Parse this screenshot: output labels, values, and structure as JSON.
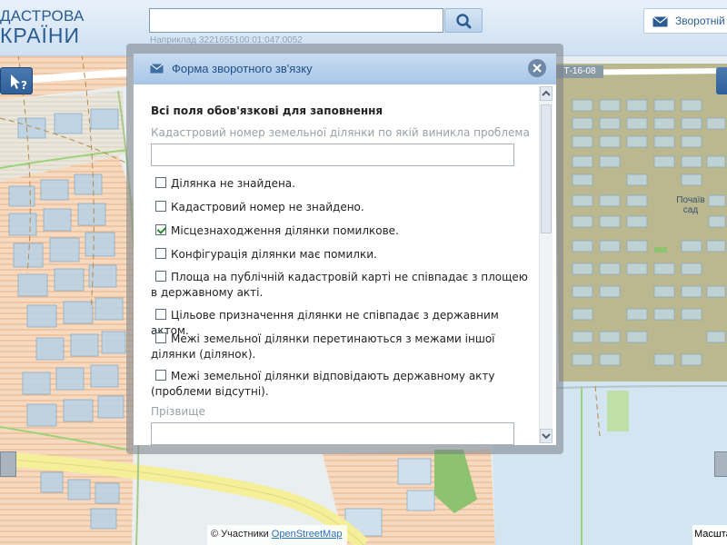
{
  "header": {
    "logo_line1": "ДАСТРОВА",
    "logo_line2": "КРАЇНИ",
    "search": {
      "value": "",
      "placeholder": ""
    },
    "search_hint": "Наприклад 3221655100:01:047:0052",
    "feedback_label": "Зворотній"
  },
  "dialog": {
    "title": "Форма зворотного зв'язку",
    "required_note": "Всі поля обов'язкові для заповнення",
    "cadastral_label": "Кадастровий номер земельної ділянки по якій виникла проблема",
    "cadastral_value": "",
    "checkboxes": [
      {
        "label": "Ділянка не знайдена.",
        "checked": false
      },
      {
        "label": "Кадастровий номер не знайдено.",
        "checked": false
      },
      {
        "label": "Місцезнаходження ділянки помилкове.",
        "checked": true
      },
      {
        "label": "Конфігурація ділянки має помилки.",
        "checked": false
      },
      {
        "label": "Площа на публічній кадастровій карті не співпадає з площею в державному акті.",
        "checked": false
      },
      {
        "label": "Цільове призначення ділянки не співпадає з державним актом.",
        "checked": false
      },
      {
        "label": "Межі земельної ділянки перетинаються з межами іншої ділянки (ділянок).",
        "checked": false
      },
      {
        "label": "Межі земельної ділянки відповідають державному акту (проблеми відсутні).",
        "checked": false
      }
    ],
    "surname_label": "Прізвище",
    "surname_value": ""
  },
  "map": {
    "road_tag": "Т-16-08",
    "place_label": "Почаїв сад",
    "attribution_prefix": "© Участники ",
    "attribution_link": "OpenStreetMap",
    "scale_label": "Масштаб"
  },
  "colors": {
    "header_bg": "#cfe0f1",
    "accent": "#2a5c94",
    "parcel_fill": "#c5dbea",
    "hatch_orange": "#f3c9a3",
    "olive_area": "#b5b38a"
  }
}
